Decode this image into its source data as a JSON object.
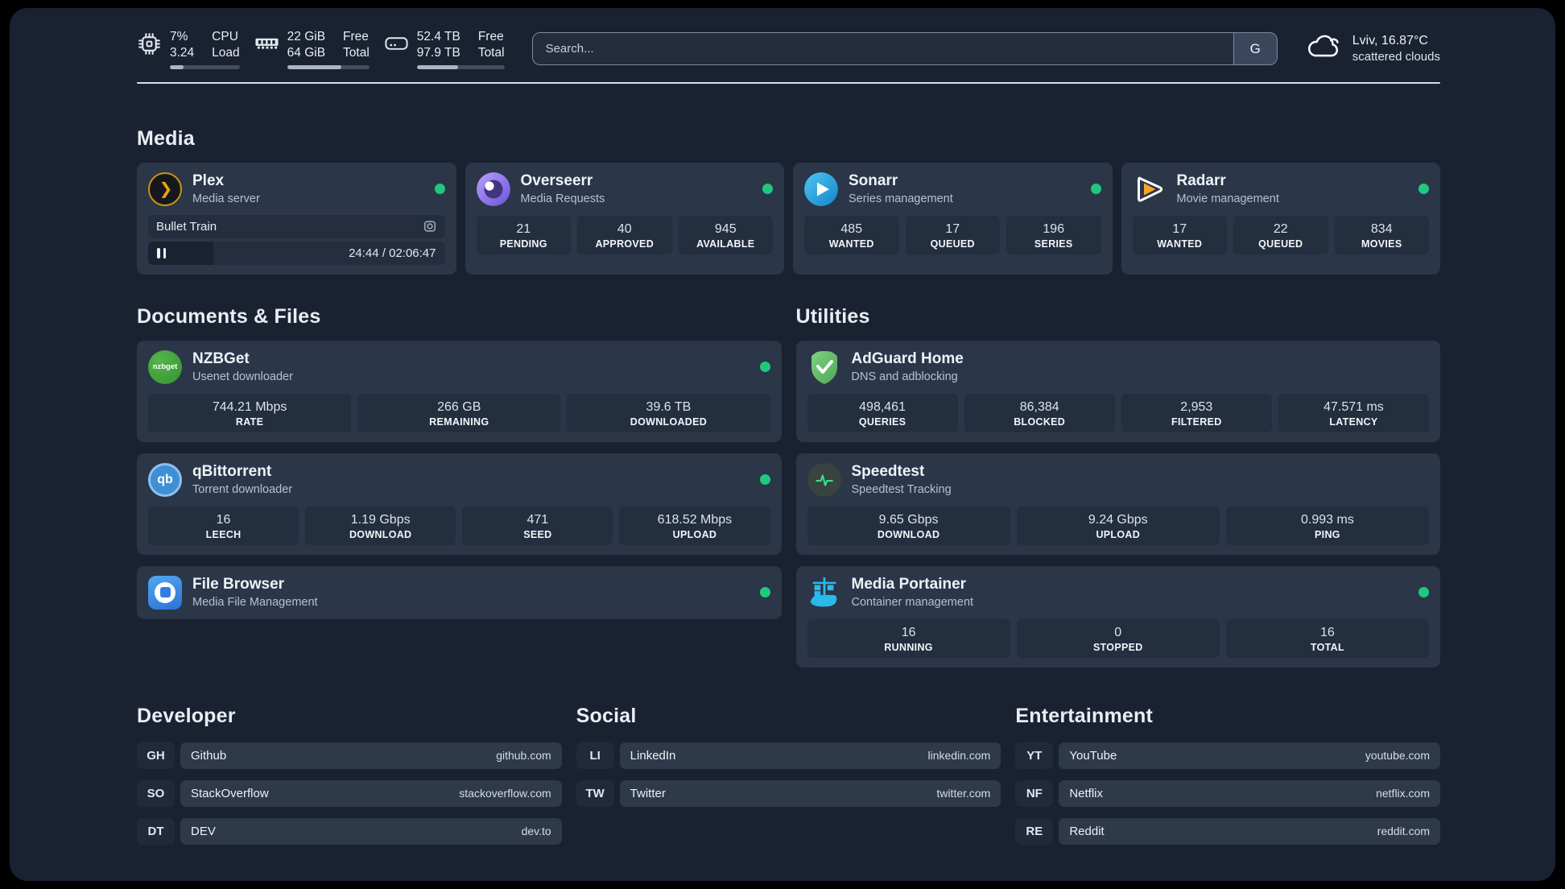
{
  "topbar": {
    "cpu": {
      "values": [
        "7%",
        "3.24"
      ],
      "labels": [
        "CPU",
        "Load"
      ],
      "progress_pct": 20
    },
    "memory": {
      "values": [
        "22 GiB",
        "64 GiB"
      ],
      "labels": [
        "Free",
        "Total"
      ],
      "progress_pct": 66
    },
    "storage": {
      "values": [
        "52.4 TB",
        "97.9 TB"
      ],
      "labels": [
        "Free",
        "Total"
      ],
      "progress_pct": 47
    },
    "search": {
      "placeholder": "Search...",
      "engine": "G"
    },
    "weather": {
      "headline": "Lviv, 16.87°C",
      "condition": "scattered clouds"
    }
  },
  "media": {
    "title": "Media",
    "plex": {
      "name": "Plex",
      "subtitle": "Media server",
      "now_playing": {
        "title": "Bullet Train",
        "time_display": "24:44 / 02:06:47",
        "progress_pct": 22
      }
    },
    "overseerr": {
      "name": "Overseerr",
      "subtitle": "Media Requests",
      "stats": [
        {
          "value": "21",
          "label": "PENDING"
        },
        {
          "value": "40",
          "label": "APPROVED"
        },
        {
          "value": "945",
          "label": "AVAILABLE"
        }
      ]
    },
    "sonarr": {
      "name": "Sonarr",
      "subtitle": "Series management",
      "stats": [
        {
          "value": "485",
          "label": "WANTED"
        },
        {
          "value": "17",
          "label": "QUEUED"
        },
        {
          "value": "196",
          "label": "SERIES"
        }
      ]
    },
    "radarr": {
      "name": "Radarr",
      "subtitle": "Movie management",
      "stats": [
        {
          "value": "17",
          "label": "WANTED"
        },
        {
          "value": "22",
          "label": "QUEUED"
        },
        {
          "value": "834",
          "label": "MOVIES"
        }
      ]
    }
  },
  "documents": {
    "title": "Documents & Files",
    "nzbget": {
      "name": "NZBGet",
      "subtitle": "Usenet downloader",
      "icon_text": "nzbget",
      "stats": [
        {
          "value": "744.21 Mbps",
          "label": "RATE"
        },
        {
          "value": "266 GB",
          "label": "REMAINING"
        },
        {
          "value": "39.6 TB",
          "label": "DOWNLOADED"
        }
      ]
    },
    "qbittorrent": {
      "name": "qBittorrent",
      "subtitle": "Torrent downloader",
      "icon_text": "qb",
      "stats": [
        {
          "value": "16",
          "label": "LEECH"
        },
        {
          "value": "1.19 Gbps",
          "label": "DOWNLOAD"
        },
        {
          "value": "471",
          "label": "SEED"
        },
        {
          "value": "618.52 Mbps",
          "label": "UPLOAD"
        }
      ]
    },
    "filebrowser": {
      "name": "File Browser",
      "subtitle": "Media File Management"
    }
  },
  "utilities": {
    "title": "Utilities",
    "adguard": {
      "name": "AdGuard Home",
      "subtitle": "DNS and adblocking",
      "stats": [
        {
          "value": "498,461",
          "label": "QUERIES"
        },
        {
          "value": "86,384",
          "label": "BLOCKED"
        },
        {
          "value": "2,953",
          "label": "FILTERED"
        },
        {
          "value": "47.571 ms",
          "label": "LATENCY"
        }
      ]
    },
    "speedtest": {
      "name": "Speedtest",
      "subtitle": "Speedtest Tracking",
      "stats": [
        {
          "value": "9.65 Gbps",
          "label": "DOWNLOAD"
        },
        {
          "value": "9.24 Gbps",
          "label": "UPLOAD"
        },
        {
          "value": "0.993 ms",
          "label": "PING"
        }
      ]
    },
    "portainer": {
      "name": "Media Portainer",
      "subtitle": "Container management",
      "stats": [
        {
          "value": "16",
          "label": "RUNNING"
        },
        {
          "value": "0",
          "label": "STOPPED"
        },
        {
          "value": "16",
          "label": "TOTAL"
        }
      ]
    }
  },
  "links": {
    "developer": {
      "title": "Developer",
      "items": [
        {
          "tag": "GH",
          "name": "Github",
          "url": "github.com"
        },
        {
          "tag": "SO",
          "name": "StackOverflow",
          "url": "stackoverflow.com"
        },
        {
          "tag": "DT",
          "name": "DEV",
          "url": "dev.to"
        }
      ]
    },
    "social": {
      "title": "Social",
      "items": [
        {
          "tag": "LI",
          "name": "LinkedIn",
          "url": "linkedin.com"
        },
        {
          "tag": "TW",
          "name": "Twitter",
          "url": "twitter.com"
        }
      ]
    },
    "entertainment": {
      "title": "Entertainment",
      "items": [
        {
          "tag": "YT",
          "name": "YouTube",
          "url": "youtube.com"
        },
        {
          "tag": "NF",
          "name": "Netflix",
          "url": "netflix.com"
        },
        {
          "tag": "RE",
          "name": "Reddit",
          "url": "reddit.com"
        }
      ]
    }
  },
  "colors": {
    "status_online": "#1fc87e",
    "panel_bg": "#1a2231",
    "card_bg": "#2b3648",
    "stat_bg": "#232e3f",
    "accent_green_pulse": "#35e08a"
  }
}
